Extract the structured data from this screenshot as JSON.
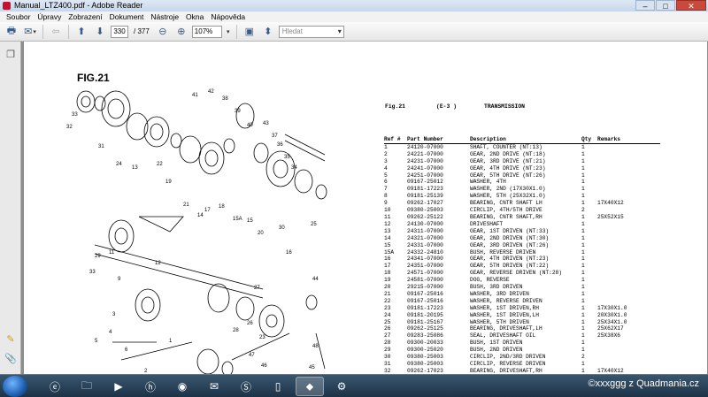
{
  "window": {
    "title": "Manual_LTZ400.pdf - Adobe Reader",
    "minimize": "–",
    "maximize": "□",
    "close": "✕"
  },
  "menu": [
    "Soubor",
    "Úpravy",
    "Zobrazení",
    "Dokument",
    "Nástroje",
    "Okna",
    "Nápověda"
  ],
  "toolbar": {
    "page_current": "330",
    "page_total": "/ 377",
    "zoom": "107%",
    "search_placeholder": "Hledat"
  },
  "document": {
    "fig_title": "FIG.21",
    "header": {
      "fig": "Fig.21",
      "code": "(E-3   )",
      "title": "TRANSMISSION"
    },
    "columns": [
      "Ref #",
      "Part Number",
      "Description",
      "Qty",
      "Remarks"
    ],
    "rows": [
      [
        "1",
        "24120-07000",
        "SHAFT, COUNTER (NT:13)",
        "1",
        ""
      ],
      [
        "2",
        "24221-07000",
        "GEAR, 2ND DRIVE (NT:18)",
        "1",
        ""
      ],
      [
        "3",
        "24231-07000",
        "GEAR, 3RD DRIVE (NT:21)",
        "1",
        ""
      ],
      [
        "4",
        "24241-07000",
        "GEAR, 4TH DRIVE (NT:23)",
        "1",
        ""
      ],
      [
        "5",
        "24251-07000",
        "GEAR, 5TH DRIVE (NT:26)",
        "1",
        ""
      ],
      [
        "6",
        "09167-25012",
        "WASHER, 4TH",
        "1",
        ""
      ],
      [
        "7",
        "09181-17223",
        "WASHER, 2ND (17X30X1.0)",
        "1",
        ""
      ],
      [
        "8",
        "09181-25139",
        "WASHER, 5TH (25X32X1.0)",
        "1",
        ""
      ],
      [
        "9",
        "09262-17027",
        "BEARING, CNTR SHAFT LH",
        "1",
        "17X40X12"
      ],
      [
        "10",
        "09380-25003",
        "CIRCLIP, 4TH/5TH DRIVE",
        "2",
        ""
      ],
      [
        "11",
        "09262-25122",
        "BEARING, CNTR SHAFT,RH",
        "1",
        "25X52X15"
      ],
      [
        "12",
        "24130-07000",
        "DRIVESHAFT",
        "1",
        ""
      ],
      [
        "13",
        "24311-07000",
        "GEAR, 1ST DRIVEN (NT:33)",
        "1",
        ""
      ],
      [
        "14",
        "24321-07000",
        "GEAR, 2ND DRIVEN (NT:30)",
        "1",
        ""
      ],
      [
        "15",
        "24331-07000",
        "GEAR, 3RD DRIVEN (NT:26)",
        "1",
        ""
      ],
      [
        "15A",
        "24332-24810",
        "BUSH, REVERSE DRIVEN",
        "1",
        ""
      ],
      [
        "16",
        "24341-07000",
        "GEAR, 4TH DRIVEN (NT:23)",
        "1",
        ""
      ],
      [
        "17",
        "24351-07000",
        "GEAR, 5TH DRIVEN (NT:22)",
        "1",
        ""
      ],
      [
        "18",
        "24571-07000",
        "GEAR, REVERSE DRIVEN (NT:28)",
        "1",
        ""
      ],
      [
        "19",
        "24581-07000",
        "DOG, REVERSE",
        "1",
        ""
      ],
      [
        "20",
        "29215-07000",
        "BUSH, 3RD DRIVEN",
        "1",
        ""
      ],
      [
        "21",
        "09167-25016",
        "WASHER, 3RD DRIVEN",
        "1",
        ""
      ],
      [
        "22",
        "09167-25016",
        "WASHER, REVERSE DRIVEN",
        "1",
        ""
      ],
      [
        "23",
        "09181-17223",
        "WASHER, 1ST DRIVEN,RH",
        "1",
        "17X30X1.0"
      ],
      [
        "24",
        "09181-20195",
        "WASHER, 1ST DRIVEN,LH",
        "1",
        "20X30X1.0"
      ],
      [
        "25",
        "09181-25167",
        "WASHER, 5TH DRIVEN",
        "1",
        "25X34X1.0"
      ],
      [
        "26",
        "09262-25125",
        "BEARING, DRIVESHAFT,LH",
        "1",
        "25X62X17"
      ],
      [
        "27",
        "09283-25086",
        "SEAL, DRIVESHAFT OIL",
        "1",
        "25X38X6"
      ],
      [
        "28",
        "09300-20033",
        "BUSH, 1ST DRIVEN",
        "1",
        ""
      ],
      [
        "29",
        "09300-25020",
        "BUSH, 2ND DRIVEN",
        "1",
        ""
      ],
      [
        "30",
        "09380-25003",
        "CIRCLIP, 2ND/3RD DRIVEN",
        "2",
        ""
      ],
      [
        "31",
        "09380-25003",
        "CIRCLIP, REVERSE DRIVEN",
        "1",
        ""
      ],
      [
        "32",
        "09262-17023",
        "BEARING, DRIVESHAFT,RH",
        "1",
        "17X40X12"
      ]
    ],
    "callouts": [
      "41",
      "42",
      "38",
      "39",
      "40",
      "43",
      "37",
      "36",
      "35",
      "34",
      "32",
      "33",
      "31",
      "24",
      "22",
      "13",
      "19",
      "21",
      "14",
      "17",
      "18",
      "15A",
      "15",
      "20",
      "30",
      "25",
      "16",
      "11",
      "12",
      "33",
      "29",
      "9",
      "44",
      "27",
      "26",
      "28",
      "23",
      "3",
      "4",
      "5",
      "6",
      "2",
      "1",
      "46",
      "47",
      "48",
      "45"
    ]
  },
  "taskbar": {
    "watermark": "©xxxggg z Quadmania.cz"
  }
}
